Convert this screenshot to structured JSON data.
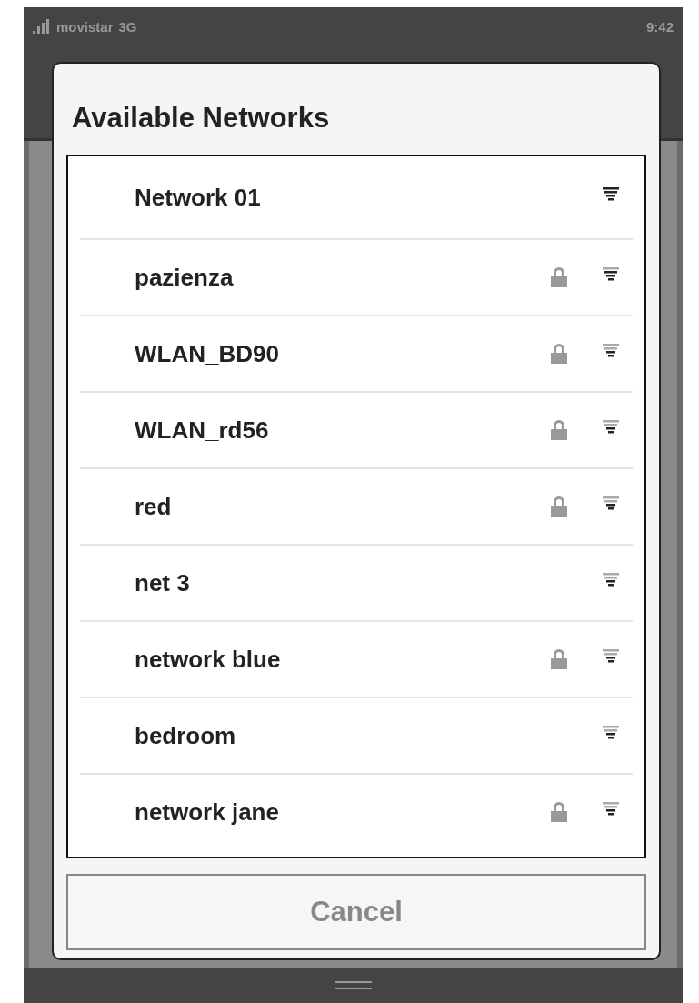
{
  "status_bar": {
    "carrier": "movistar",
    "network": "3G",
    "time": "9:42"
  },
  "dialog": {
    "title": "Available Networks",
    "networks": [
      {
        "name": "Network 01",
        "locked": false,
        "kind": "full"
      },
      {
        "name": "pazienza",
        "locked": true,
        "kind": "good"
      },
      {
        "name": "WLAN_BD90",
        "locked": true,
        "kind": "fair"
      },
      {
        "name": "WLAN_rd56",
        "locked": true,
        "kind": "fair"
      },
      {
        "name": "red",
        "locked": true,
        "kind": "fair"
      },
      {
        "name": "net 3",
        "locked": false,
        "kind": "fair"
      },
      {
        "name": "network blue",
        "locked": true,
        "kind": "fair"
      },
      {
        "name": "bedroom",
        "locked": false,
        "kind": "fair"
      },
      {
        "name": "network jane",
        "locked": true,
        "kind": "fair"
      }
    ],
    "cancel": "Cancel"
  }
}
